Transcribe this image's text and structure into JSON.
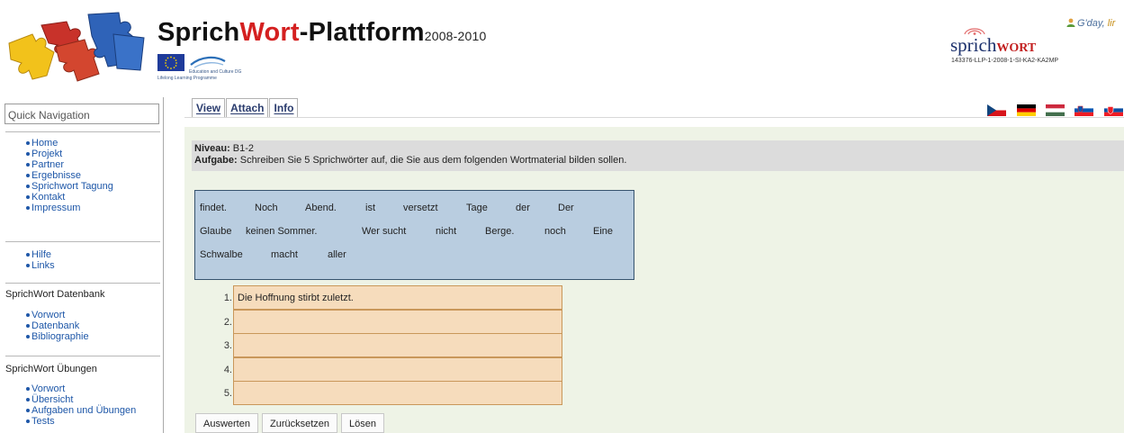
{
  "header": {
    "title_part1": "Sprich",
    "title_part2": "Wort",
    "title_part3": "-Plattform",
    "title_years": "2008-2010",
    "llp_label": "Lifelong Learning Programme",
    "llp_sub": "Education and Culture DG",
    "logo_word": "sprich",
    "logo_word_caps": "WORT",
    "project_code": "143376-LLP-1-2008-1-SI-KA2-KA2MP",
    "greeting": "G'day, ",
    "username": "lir",
    "icons": [
      "puzzle-logo",
      "eu-flag",
      "llp-logo",
      "sprichwort-logo",
      "user-icon"
    ]
  },
  "sidebar": {
    "quick_nav_placeholder": "Quick Navigation",
    "main_links": [
      "Home",
      "Projekt",
      "Partner",
      "Ergebnisse",
      "Sprichwort Tagung",
      "Kontakt",
      "Impressum"
    ],
    "help_links": [
      "Hilfe",
      "Links"
    ],
    "datenbank_title": "SprichWort Datenbank",
    "datenbank_links": [
      "Vorwort",
      "Datenbank",
      "Bibliographie"
    ],
    "uebungen_title": "SprichWort Übungen",
    "uebungen_links": [
      "Vorwort",
      "Übersicht",
      "Aufgaben und Übungen",
      "Tests"
    ]
  },
  "tabs": [
    {
      "label": "View"
    },
    {
      "label": "Attach"
    },
    {
      "label": "Info"
    }
  ],
  "flags": [
    {
      "name": "czech-flag-icon"
    },
    {
      "name": "german-flag-icon"
    },
    {
      "name": "hungarian-flag-icon"
    },
    {
      "name": "slovenian-flag-icon"
    },
    {
      "name": "slovak-flag-icon"
    }
  ],
  "task": {
    "niveau_label": "Niveau:",
    "niveau_value": " B1-2",
    "aufgabe_label": "Aufgabe:",
    "aufgabe_value": " Schreiben Sie 5 Sprichwörter auf, die Sie aus dem folgenden Wortmaterial bilden sollen.",
    "words_row1": [
      "findet.",
      "Noch",
      "Abend.",
      "ist",
      "versetzt",
      "Tage",
      "der",
      "Der"
    ],
    "words_row2": [
      "Glaube",
      "keinen Sommer.",
      "Wer sucht",
      "nicht",
      "Berge.",
      "noch",
      "Eine"
    ],
    "words_row3": [
      "Schwalbe",
      "macht",
      "aller"
    ],
    "answers": [
      {
        "num": "1.",
        "value": "Die  Hoffnung  stirbt  zuletzt."
      },
      {
        "num": "2.",
        "value": ""
      },
      {
        "num": "3.",
        "value": ""
      },
      {
        "num": "4.",
        "value": ""
      },
      {
        "num": "5.",
        "value": ""
      }
    ],
    "buttons": {
      "evaluate": "Auswerten",
      "reset": "Zurücksetzen",
      "solve": "Lösen"
    }
  },
  "colors": {
    "accent_red": "#d42020",
    "link_blue": "#1e57a8",
    "content_bg": "#eef3e6",
    "word_box_bg": "#b9cde0",
    "answer_bg": "#f6dcbc"
  }
}
